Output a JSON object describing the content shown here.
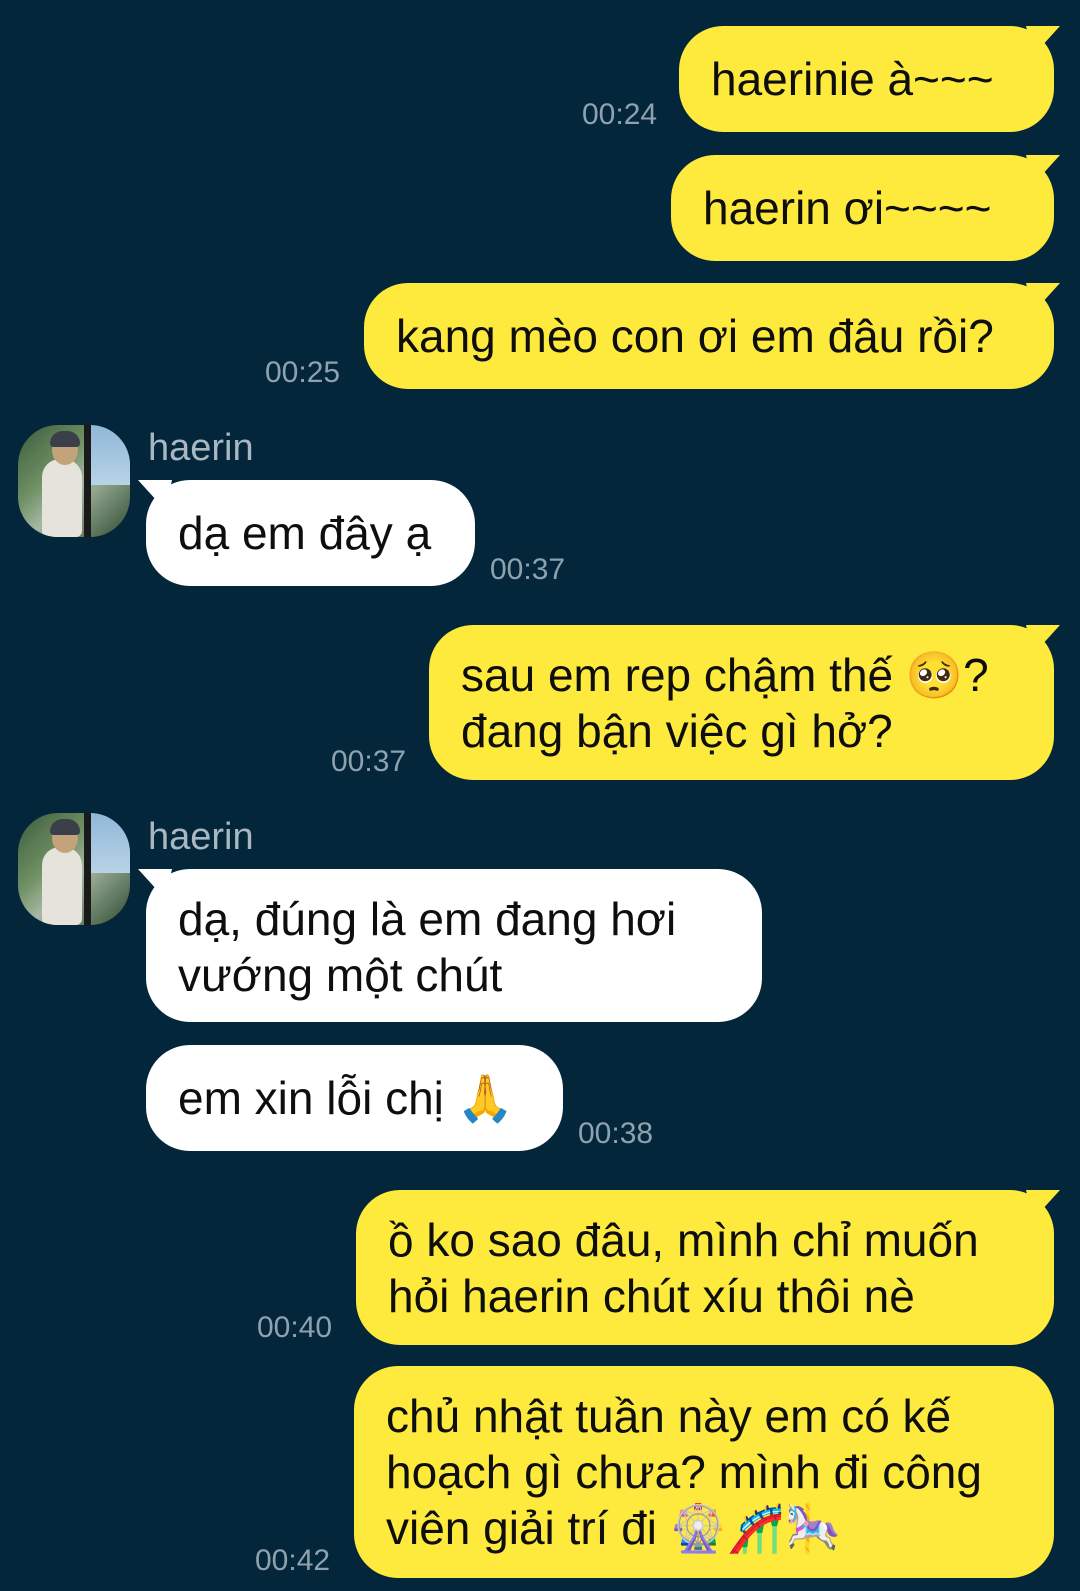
{
  "messages": [
    {
      "text": "haerinie à~~~",
      "time": "00:24"
    },
    {
      "text": "haerin ơi~~~~"
    },
    {
      "text": "kang mèo con ơi em đâu rồi?",
      "time": "00:25"
    },
    {
      "sender": "haerin",
      "text": "dạ em đây ạ",
      "time": "00:37"
    },
    {
      "line1": "sau em rep chậm thế 🥺?",
      "line2": "đang bận việc gì hở?",
      "time": "00:37"
    },
    {
      "sender": "haerin",
      "line1": "dạ, đúng là em đang hơi",
      "line2": "vướng một chút"
    },
    {
      "text": "em xin lỗi chị 🙏",
      "time": "00:38"
    },
    {
      "line1": "ồ ko sao đâu, mình chỉ muốn",
      "line2": "hỏi haerin chút xíu thôi nè",
      "time": "00:40"
    },
    {
      "line1": "chủ nhật tuần này em có kế",
      "line2": "hoạch gì chưa? mình đi công",
      "line3": "viên giải trí đi 🎡🎢🎠",
      "time": "00:42"
    }
  ],
  "colors": {
    "background": "#04263b",
    "my_bubble": "#fee93d",
    "their_bubble": "#ffffff",
    "timestamp": "#8fa1ae",
    "sender_name": "#a9b7c1"
  }
}
